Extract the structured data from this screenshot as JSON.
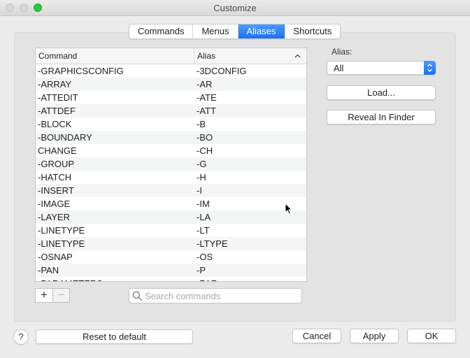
{
  "window": {
    "title": "Customize"
  },
  "tabs": [
    {
      "label": "Commands",
      "active": false
    },
    {
      "label": "Menus",
      "active": false
    },
    {
      "label": "Aliases",
      "active": true
    },
    {
      "label": "Shortcuts",
      "active": false
    }
  ],
  "table": {
    "columns": {
      "command": "Command",
      "alias": "Alias"
    },
    "sort": "ascending",
    "rows": [
      {
        "command": "-GRAPHICSCONFIG",
        "alias": "-3DCONFIG"
      },
      {
        "command": "-ARRAY",
        "alias": "-AR"
      },
      {
        "command": "-ATTEDIT",
        "alias": "-ATE"
      },
      {
        "command": "-ATTDEF",
        "alias": "-ATT"
      },
      {
        "command": "-BLOCK",
        "alias": "-B"
      },
      {
        "command": "-BOUNDARY",
        "alias": "-BO"
      },
      {
        "command": "CHANGE",
        "alias": "-CH"
      },
      {
        "command": "-GROUP",
        "alias": "-G"
      },
      {
        "command": "-HATCH",
        "alias": "-H"
      },
      {
        "command": "-INSERT",
        "alias": "-I"
      },
      {
        "command": "-IMAGE",
        "alias": "-IM"
      },
      {
        "command": "-LAYER",
        "alias": "-LA"
      },
      {
        "command": "-LINETYPE",
        "alias": "-LT"
      },
      {
        "command": "-LINETYPE",
        "alias": "-LTYPE"
      },
      {
        "command": "-OSNAP",
        "alias": "-OS"
      },
      {
        "command": "-PAN",
        "alias": "-P"
      },
      {
        "command": "-PARAMETERS",
        "alias": "-PAR"
      }
    ]
  },
  "list_controls": {
    "add": "+",
    "remove": "−"
  },
  "search": {
    "placeholder": "Search commands",
    "value": ""
  },
  "sidebar": {
    "alias_label": "Alias:",
    "alias_filter": {
      "selected": "All"
    },
    "load_button": "Load...",
    "reveal_button": "Reveal In Finder"
  },
  "footer": {
    "help": "?",
    "reset_button": "Reset to default",
    "cancel_button": "Cancel",
    "apply_button": "Apply",
    "ok_button": "OK"
  },
  "colors": {
    "accent": "#1d6ff2",
    "maximize": "#2ac840"
  }
}
